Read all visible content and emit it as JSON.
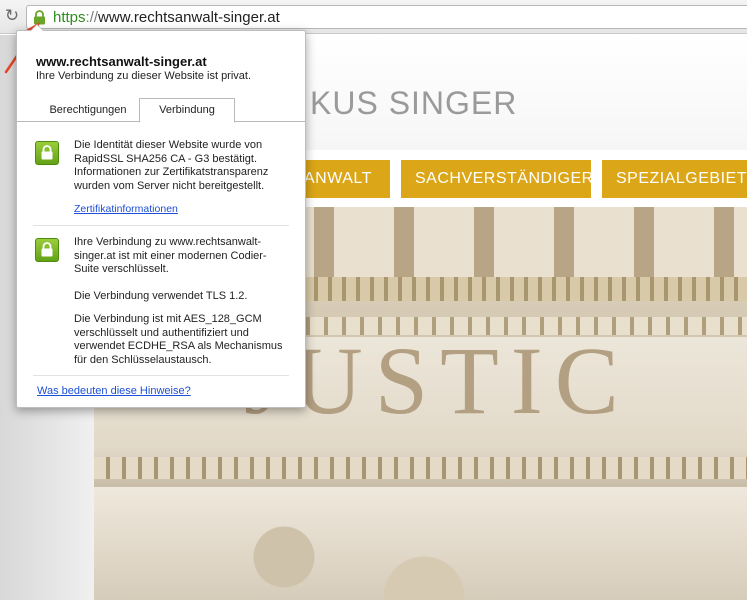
{
  "addressbar": {
    "scheme": "https",
    "separator": "://",
    "host": "www.rechtsanwalt-singer.at"
  },
  "site": {
    "logo_text": "KUS SINGER",
    "nav": [
      "ANWALT",
      "SACHVERSTÄNDIGER",
      "SPEZIALGEBIETE"
    ],
    "hero_text": "JUSTIC"
  },
  "popup": {
    "domain": "www.rechtsanwalt-singer.at",
    "privacy_text": "Ihre Verbindung zu dieser Website ist privat.",
    "tabs": [
      {
        "label": "Berechtigungen",
        "active": false
      },
      {
        "label": "Verbindung",
        "active": true
      }
    ],
    "identity_text": "Die Identität dieser Website wurde von RapidSSL SHA256 CA - G3 bestätigt. Informationen zur Zertifikatstransparenz wurden vom Server nicht bereitgestellt.",
    "certificate_link": "Zertifikatinformationen",
    "connection_text": "Ihre Verbindung zu www.rechtsanwalt-singer.at ist mit einer modernen Codier-Suite verschlüsselt.",
    "tls_text": "Die Verbindung verwendet TLS 1.2.",
    "cipher_text": "Die Verbindung ist mit AES_128_GCM verschlüsselt und authentifiziert und verwendet ECDHE_RSA als Mechanismus für den Schlüsselaustausch.",
    "help_link": "Was bedeuten diese Hinweise?"
  },
  "colors": {
    "https_green": "#2e8b1e",
    "nav_gold": "#dba618",
    "link_blue": "#1d4fd7",
    "lock_green": "#62a216",
    "arrow_red": "#e8462a"
  }
}
